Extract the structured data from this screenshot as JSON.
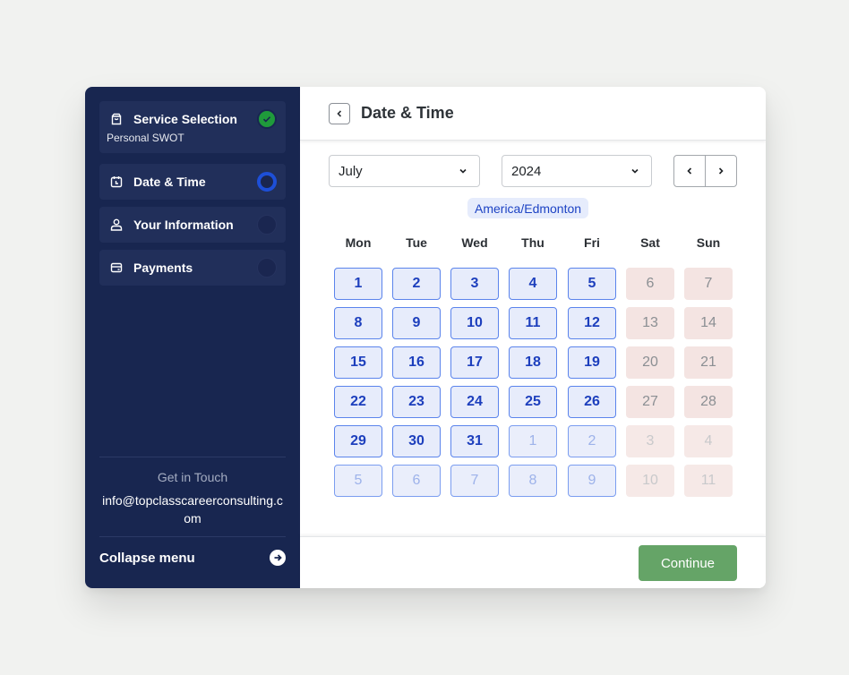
{
  "sidebar": {
    "steps": [
      {
        "label": "Service Selection",
        "sub": "Personal SWOT",
        "icon": "shopping-bag-icon",
        "status": "completed"
      },
      {
        "label": "Date & Time",
        "icon": "calendar-clock-icon",
        "status": "active"
      },
      {
        "label": "Your Information",
        "icon": "user-icon",
        "status": "pending"
      },
      {
        "label": "Payments",
        "icon": "credit-card-icon",
        "status": "pending"
      }
    ],
    "contact_title": "Get in Touch",
    "contact_email": "info@topclasscareerconsulting.com",
    "collapse_label": "Collapse menu"
  },
  "header": {
    "title": "Date & Time"
  },
  "calendar": {
    "month": "July",
    "year": "2024",
    "timezone": "America/Edmonton",
    "weekdays": [
      "Mon",
      "Tue",
      "Wed",
      "Thu",
      "Fri",
      "Sat",
      "Sun"
    ],
    "weeks": [
      [
        {
          "d": "1",
          "t": "avail"
        },
        {
          "d": "2",
          "t": "avail"
        },
        {
          "d": "3",
          "t": "avail"
        },
        {
          "d": "4",
          "t": "avail"
        },
        {
          "d": "5",
          "t": "avail"
        },
        {
          "d": "6",
          "t": "weekend"
        },
        {
          "d": "7",
          "t": "weekend"
        }
      ],
      [
        {
          "d": "8",
          "t": "avail"
        },
        {
          "d": "9",
          "t": "avail"
        },
        {
          "d": "10",
          "t": "avail"
        },
        {
          "d": "11",
          "t": "avail"
        },
        {
          "d": "12",
          "t": "avail"
        },
        {
          "d": "13",
          "t": "weekend"
        },
        {
          "d": "14",
          "t": "weekend"
        }
      ],
      [
        {
          "d": "15",
          "t": "avail"
        },
        {
          "d": "16",
          "t": "avail"
        },
        {
          "d": "17",
          "t": "avail"
        },
        {
          "d": "18",
          "t": "avail"
        },
        {
          "d": "19",
          "t": "avail"
        },
        {
          "d": "20",
          "t": "weekend"
        },
        {
          "d": "21",
          "t": "weekend"
        }
      ],
      [
        {
          "d": "22",
          "t": "avail"
        },
        {
          "d": "23",
          "t": "avail"
        },
        {
          "d": "24",
          "t": "avail"
        },
        {
          "d": "25",
          "t": "avail"
        },
        {
          "d": "26",
          "t": "avail"
        },
        {
          "d": "27",
          "t": "weekend"
        },
        {
          "d": "28",
          "t": "weekend"
        }
      ],
      [
        {
          "d": "29",
          "t": "avail"
        },
        {
          "d": "30",
          "t": "avail"
        },
        {
          "d": "31",
          "t": "avail"
        },
        {
          "d": "1",
          "t": "other"
        },
        {
          "d": "2",
          "t": "other"
        },
        {
          "d": "3",
          "t": "weekend other"
        },
        {
          "d": "4",
          "t": "weekend other"
        }
      ],
      [
        {
          "d": "5",
          "t": "other"
        },
        {
          "d": "6",
          "t": "other"
        },
        {
          "d": "7",
          "t": "other"
        },
        {
          "d": "8",
          "t": "other"
        },
        {
          "d": "9",
          "t": "other"
        },
        {
          "d": "10",
          "t": "weekend other"
        },
        {
          "d": "11",
          "t": "weekend other"
        }
      ]
    ]
  },
  "footer": {
    "continue_label": "Continue"
  },
  "colors": {
    "sidebar_bg": "#182650",
    "accent_blue": "#1d4fd8",
    "success_green": "#1f9a3b",
    "continue_green": "#65a467"
  }
}
